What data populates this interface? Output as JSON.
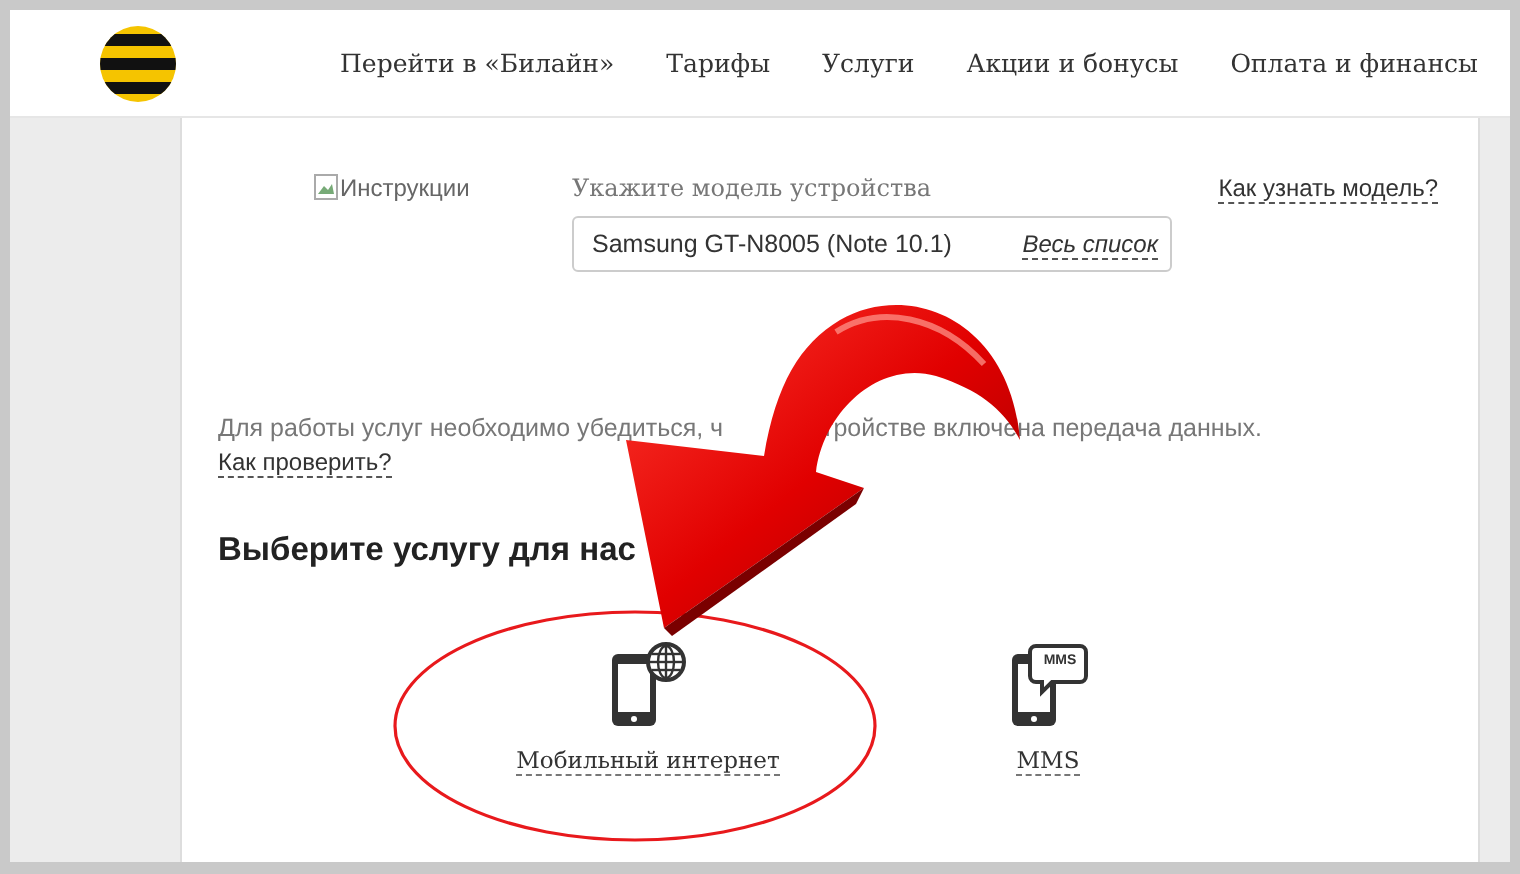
{
  "header": {
    "nav": [
      "Перейти в «Билайн»",
      "Тарифы",
      "Услуги",
      "Акции и бонусы",
      "Оплата и финансы"
    ]
  },
  "device": {
    "image_alt": "Инструкции",
    "label": "Укажите модель устройства",
    "help_link": "Как узнать модель?",
    "model": "Samsung GT-N8005 (Note 10.1)",
    "list_link": "Весь список"
  },
  "notice": {
    "text_before": "Для работы услуг необходимо убедиться, ч",
    "text_after": "тройстве включена передача данных.",
    "link": "Как проверить?"
  },
  "heading": "Выберите услугу для нас",
  "services": [
    {
      "kind": "internet",
      "label": "Мобильный интернет",
      "highlighted": true
    },
    {
      "kind": "mms",
      "label": "MMS",
      "badge": "MMS",
      "highlighted": false
    }
  ]
}
